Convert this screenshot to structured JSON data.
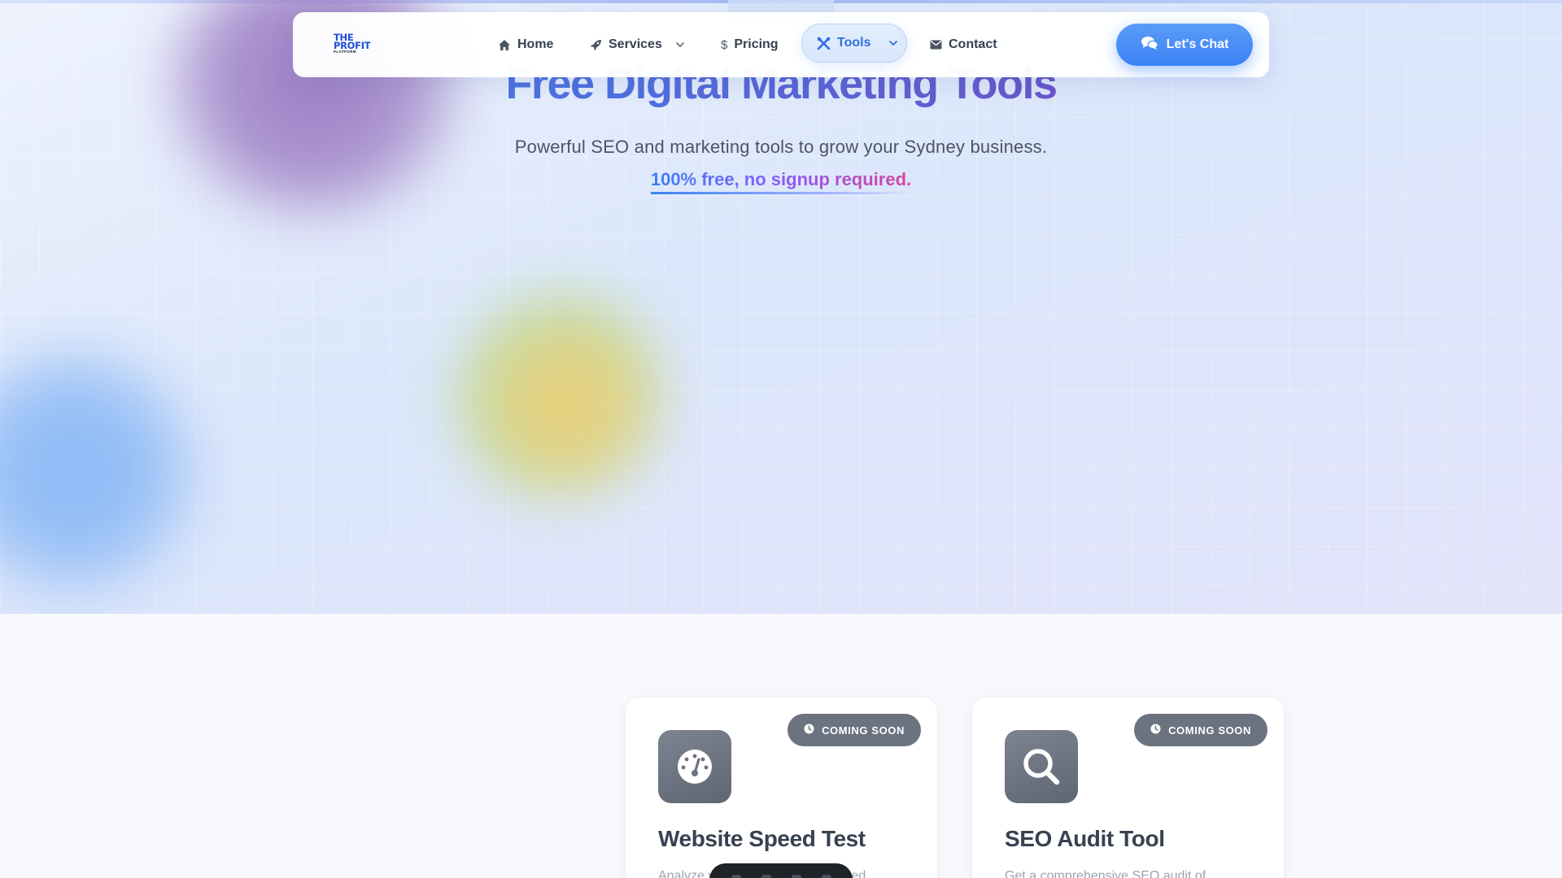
{
  "nav": {
    "logo": {
      "line1": "THE",
      "line2": "PROFIT",
      "line3": "PLATFORM"
    },
    "items": [
      {
        "label": "Home",
        "icon": "home-icon"
      },
      {
        "label": "Services",
        "icon": "rocket-icon",
        "has_dropdown": true
      },
      {
        "label": "Pricing",
        "icon": "dollar-icon"
      },
      {
        "label": "Tools",
        "icon": "tools-icon",
        "has_dropdown": true,
        "active": true
      },
      {
        "label": "Contact",
        "icon": "envelope-icon"
      }
    ],
    "cta_label": "Let's Chat",
    "cta_icon": "chat-bubbles-icon"
  },
  "hero": {
    "title": "Free Digital Marketing Tools",
    "subtitle": "Powerful SEO and marketing tools to grow your Sydney business.",
    "highlight": "100% free, no signup required."
  },
  "tools": [
    {
      "badge": "COMING SOON",
      "icon": "speedometer-icon",
      "title": "Website Speed Test",
      "description": "Analyze your website loading speed"
    },
    {
      "badge": "COMING SOON",
      "icon": "magnifier-icon",
      "title": "SEO Audit Tool",
      "description": "Get a comprehensive SEO audit of"
    }
  ],
  "colors": {
    "accent": "#3b82f6",
    "badge": "#6b7280",
    "text": "#374151"
  }
}
